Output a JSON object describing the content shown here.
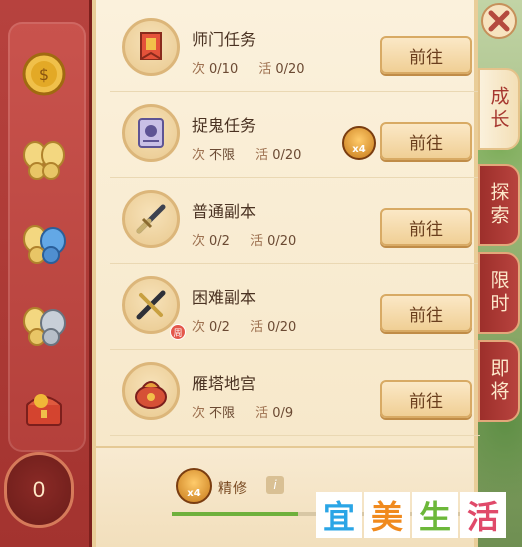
{
  "tasks": [
    {
      "title": "师门任务",
      "count_label": "次",
      "count": "0/10",
      "active_label": "活",
      "active": "0/20",
      "button": "前往",
      "icon": "banner-icon"
    },
    {
      "title": "捉鬼任务",
      "count_label": "次",
      "count": "不限",
      "active_label": "活",
      "active": "0/20",
      "button": "前往",
      "icon": "scroll-icon",
      "badge": "x4"
    },
    {
      "title": "普通副本",
      "count_label": "次",
      "count": "0/2",
      "active_label": "活",
      "active": "0/20",
      "button": "前往",
      "icon": "sword-icon"
    },
    {
      "title": "困难副本",
      "count_label": "次",
      "count": "0/2",
      "active_label": "活",
      "active": "0/20",
      "button": "前往",
      "icon": "crossed-swords-icon",
      "weekly_badge": "周"
    },
    {
      "title": "雁塔地宫",
      "count_label": "次",
      "count": "不限",
      "active_label": "活",
      "active": "0/9",
      "button": "前往",
      "icon": "treasure-bag-icon"
    }
  ],
  "tabs": [
    {
      "label": "成长",
      "active": true
    },
    {
      "label": "探索",
      "active": false
    },
    {
      "label": "限时",
      "active": false
    },
    {
      "label": "即将",
      "active": false
    }
  ],
  "left_rail": {
    "counter": "0"
  },
  "bottom": {
    "refine_badge": "x4",
    "refine_label": "精修",
    "info": "i",
    "progress": 0.42
  },
  "watermark": [
    "宜",
    "美",
    "生",
    "活"
  ],
  "colors": {
    "accent_red": "#b8433e",
    "paper": "#fbf1dc",
    "button": "#f0cf95",
    "progress": "#6fb03c"
  }
}
